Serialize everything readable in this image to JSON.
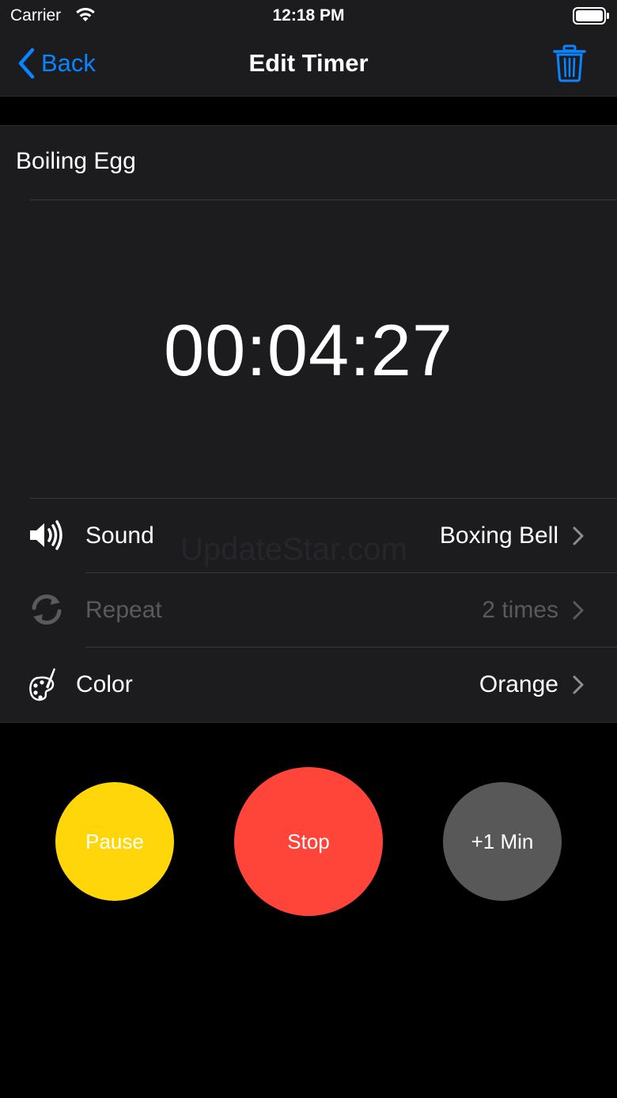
{
  "status_bar": {
    "carrier": "Carrier",
    "time": "12:18 PM"
  },
  "nav": {
    "back_label": "Back",
    "title": "Edit Timer"
  },
  "timer": {
    "name": "Boiling Egg",
    "display": "00:04:27"
  },
  "settings": [
    {
      "label": "Sound",
      "value": "Boxing Bell",
      "icon": "speaker-icon",
      "enabled": true
    },
    {
      "label": "Repeat",
      "value": "2 times",
      "icon": "repeat-icon",
      "enabled": false
    },
    {
      "label": "Color",
      "value": "Orange",
      "icon": "palette-icon",
      "enabled": true
    }
  ],
  "watermark": "UpdateStar.com",
  "controls": {
    "pause_label": "Pause",
    "stop_label": "Stop",
    "add_minute_label": "+1 Min"
  },
  "colors": {
    "accent": "#0a84ff",
    "pause": "#ffd60a",
    "stop": "#ff453a",
    "add_minute": "#585858",
    "surface": "#1c1c1e"
  }
}
